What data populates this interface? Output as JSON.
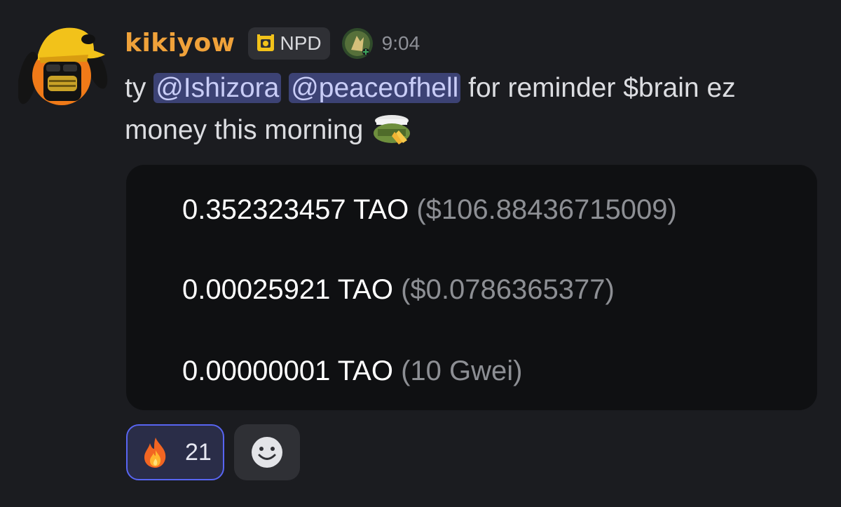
{
  "message": {
    "author": {
      "username": "kikiyow",
      "tag_label": "NPD",
      "timestamp": "9:04"
    },
    "content": {
      "prefix": "ty",
      "mentions": [
        "@Ishizora",
        "@peaceofhell"
      ],
      "text": "for reminder $brain ez money this morning",
      "emoji": "saluting-face-emoji"
    },
    "embed": {
      "lines": [
        {
          "amount": "0.352323457 TAO",
          "usd": "($106.88436715009)"
        },
        {
          "amount": "0.00025921 TAO",
          "usd": "($0.0786365377)"
        },
        {
          "amount": "0.00000001 TAO",
          "usd": "(10 Gwei)"
        }
      ]
    },
    "reactions": [
      {
        "emoji": "fire-icon",
        "count": "21"
      }
    ],
    "add_reaction_icon": "smiley-add-reaction-icon"
  },
  "colors": {
    "background": "#1b1c20",
    "username": "#f0a23a",
    "mention_bg": "#3c4274",
    "embed_bg": "#0f1012",
    "reaction_border": "#5865f2"
  }
}
